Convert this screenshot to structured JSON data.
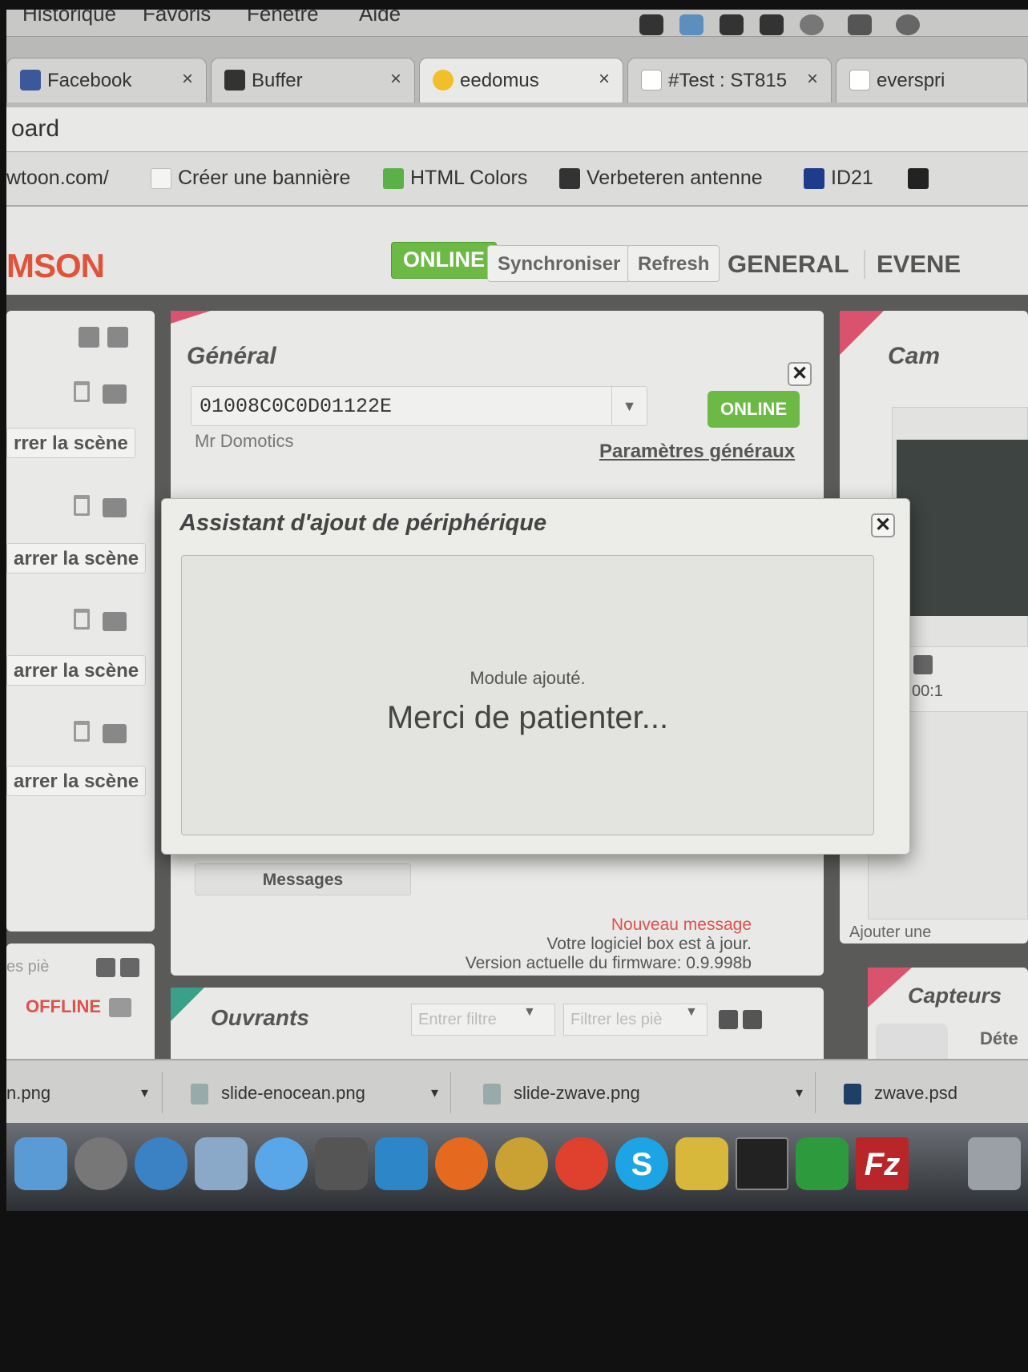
{
  "menubar": {
    "items": [
      "Historique",
      "Favoris",
      "Fenêtre",
      "Aide"
    ]
  },
  "tabs": [
    {
      "label": "Facebook",
      "close": "×"
    },
    {
      "label": "Buffer",
      "close": "×"
    },
    {
      "label": "eedomus",
      "close": "×"
    },
    {
      "label": "#Test : ST815",
      "close": "×"
    },
    {
      "label": "everspri"
    }
  ],
  "address": {
    "text": "oard"
  },
  "bookmarks": [
    {
      "label": "wtoon.com/"
    },
    {
      "label": "Créer une bannière"
    },
    {
      "label": "HTML Colors"
    },
    {
      "label": "Verbeteren antenne"
    },
    {
      "label": "ID21"
    }
  ],
  "header": {
    "logo": "MSON",
    "status": "ONLINE",
    "sync_label": "Synchroniser",
    "refresh_label": "Refresh",
    "nav_general": "GENERAL",
    "nav_events": "EVENE"
  },
  "scenes": {
    "button_label": "rrer la scène",
    "items": [
      "rrer la scène",
      "arrer la scène",
      "arrer la scène",
      "arrer la scène"
    ]
  },
  "general": {
    "title": "Général",
    "box_id": "01008C0C0D01122E",
    "owner": "Mr Domotics",
    "status": "ONLINE",
    "settings_link": "Paramètres généraux",
    "messages_tab": "Messages",
    "new_message": "Nouveau message",
    "up_to_date": "Votre logiciel box est à jour.",
    "firmware": "Version actuelle du firmware: 0.9.998b",
    "accent": "#d9536f"
  },
  "modal": {
    "title": "Assistant d'ajout de périphérique",
    "status": "Module ajouté.",
    "wait": "Merci de patienter..."
  },
  "ouvrants": {
    "title": "Ouvrants",
    "filter_placeholder": "Entrer filtre",
    "filter_pieces": "Filtrer les piè",
    "accent": "#3aa08a"
  },
  "left_bottom": {
    "filter": "es piè",
    "status": "OFFLINE"
  },
  "cameras": {
    "title": "Cam",
    "time": "00:1",
    "add": "Ajouter une"
  },
  "capteurs": {
    "title": "Capteurs",
    "item": "Déte",
    "accent": "#d9536f"
  },
  "downloads": [
    {
      "name": "n.png"
    },
    {
      "name": "slide-enocean.png"
    },
    {
      "name": "slide-zwave.png"
    },
    {
      "name": "zwave.psd"
    }
  ],
  "dock": {
    "skype_glyph": "S",
    "filezilla_glyph": "Fz"
  },
  "colors": {
    "online": "#6cba45",
    "offline": "#d9534f",
    "new_message": "#d9534f"
  }
}
